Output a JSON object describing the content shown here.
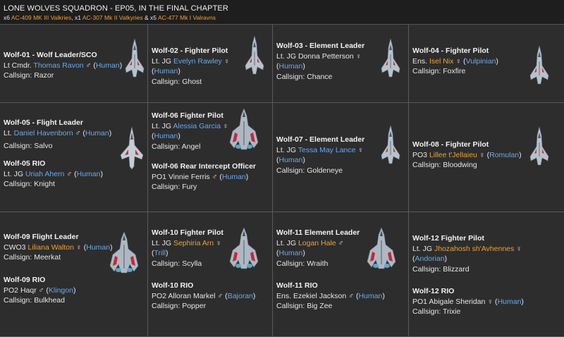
{
  "header": {
    "title": "LONE WOLVES SQUADRON - EP05, IN THE FINAL CHAPTER",
    "sub_prefix1": "x6",
    "ship1": "AC-409 MK III Valkries",
    "sub_mid1": ", x1",
    "ship2": "AC-307 Mk II Valkyries",
    "sub_mid2": " & x5",
    "ship3": "AC-477 Mk I Valravns"
  },
  "colors": {
    "accent_orange": "#f0a030",
    "link_blue": "#6aa9ea",
    "background": "#2b2b2b",
    "grid_line": "#5a5a5a"
  },
  "cells": [
    {
      "primary": {
        "role": "Wolf-01 - Wolf Leader/SCO",
        "rank": "Lt Cmdr.",
        "name": "Thomas Ravon",
        "gender": "♂",
        "species": "Human",
        "callsign_label": "Callsign:",
        "callsign": "Razor"
      },
      "ship_icon": "valkyrie-fighter-icon"
    },
    {
      "primary": {
        "role": "Wolf-02 - Fighter Pilot",
        "rank": "Lt. JG",
        "name": "Evelyn Rawley",
        "gender": "♀",
        "species": "Human",
        "callsign_label": "Callsign:",
        "callsign": "Ghost"
      },
      "ship_icon": "valkyrie-fighter-icon"
    },
    {
      "primary": {
        "role": "Wolf-03 - Element Leader",
        "rank": "Lt. JG",
        "name": "Donna Petterson",
        "gender": "♀",
        "species": "Human",
        "callsign_label": "Callsign:",
        "callsign": "Chance"
      },
      "ship_icon": "valkyrie-fighter-icon"
    },
    {
      "primary": {
        "role": "Wolf-04 - Fighter Pilot",
        "rank": "Ens.",
        "name": "Isel Nix",
        "gender": "♀",
        "species": "Vulpinian",
        "callsign_label": "Callsign:",
        "callsign": "Foxfire"
      },
      "ship_icon": "valkyrie-fighter-icon"
    },
    {
      "primary": {
        "role": "Wolf-05 - Flight Leader",
        "rank": "Lt.",
        "name": "Daniel Havenborn",
        "gender": "♂",
        "species": "Human",
        "callsign_label": "Callsign:",
        "callsign": "Salvo"
      },
      "secondary": {
        "role": "Wolf-05 RIO",
        "rank": "Lt. JG",
        "name": "Uriah Ahern",
        "gender": "♂",
        "species": "Human",
        "callsign_label": "Callsign:",
        "callsign": "Knight"
      },
      "ship_icon": "valkyrie-mk2-icon"
    },
    {
      "primary": {
        "role": "Wolf-06 Fighter Pilot",
        "rank": "Lt. JG",
        "name": "Alessia Garcia",
        "gender": "♀",
        "species": "Human",
        "callsign_label": "Callsign:",
        "callsign": "Angel"
      },
      "secondary": {
        "role": "Wolf-06 Rear Intercept Officer",
        "rank": "PO1",
        "name": "Vinnie Ferris",
        "gender": "♂",
        "species": "Human",
        "callsign_label": "Callsign:",
        "callsign": "Fury"
      },
      "ship_icon": "valravn-fighter-icon"
    },
    {
      "primary": {
        "role": "Wolf-07 - Element Leader",
        "rank": "Lt. JG",
        "name": "Tessa May Lance",
        "gender": "♀",
        "species": "Human",
        "callsign_label": "Callsign:",
        "callsign": "Goldeneye"
      },
      "ship_icon": "valkyrie-fighter-icon"
    },
    {
      "primary": {
        "role": "Wolf-08 - Fighter Pilot",
        "rank": "PO3",
        "name": "Lillee t'Jellaieu",
        "gender": "♀",
        "species": "Romulan",
        "callsign_label": "Callsign:",
        "callsign": "Bloodwing"
      },
      "ship_icon": "valkyrie-fighter-icon"
    },
    {
      "primary": {
        "role": "Wolf-09 Flight Leader",
        "rank": "CWO3",
        "name": "Liliana Walton",
        "gender": "♀",
        "species": "Human",
        "callsign_label": "Callsign:",
        "callsign": "Meerkat"
      },
      "secondary": {
        "role": "Wolf-09 RIO",
        "rank": "PO2",
        "name": "Haqr",
        "gender": "♂",
        "species": "Klingon",
        "callsign_label": "Callsign:",
        "callsign": "Bulkhead"
      },
      "ship_icon": "valravn-fighter-icon"
    },
    {
      "primary": {
        "role": "Wolf-10 Fighter Pilot",
        "rank": "Lt. JG",
        "name": "Sephiria Arn",
        "gender": "♀",
        "species": "Trill",
        "callsign_label": "Callsign:",
        "callsign": "Scylla"
      },
      "secondary": {
        "role": "Wolf-10 RIO",
        "rank": "PO2",
        "name": "Alloran Markel",
        "gender": "♂",
        "species": "Bajoran",
        "callsign_label": "Callsign:",
        "callsign": "Popper"
      },
      "ship_icon": "valravn-fighter-icon"
    },
    {
      "primary": {
        "role": "Wolf-11 Element Leader",
        "rank": "Lt. JG",
        "name": "Logan Hale",
        "gender": "♂",
        "species": "Human",
        "callsign_label": "Callsign:",
        "callsign": "Wraith"
      },
      "secondary": {
        "role": "Wolf-11 RIO",
        "rank": "Ens.",
        "name": "Ezekiel Jackson",
        "gender": "♂",
        "species": "Human",
        "callsign_label": "Callsign:",
        "callsign": "Big Zee"
      },
      "ship_icon": "valravn-fighter-icon"
    },
    {
      "primary": {
        "role": "Wolf-12 Fighter Pilot",
        "rank": "Lt. JG",
        "name": "Jhozahosh sh'Avhennes",
        "gender": "♀",
        "species": "Andorian",
        "callsign_label": "Callsign:",
        "callsign": "Blizzard"
      },
      "secondary": {
        "role": "Wolf-12 RIO",
        "rank": "PO1",
        "name": "Abigale Sheridan",
        "gender": "♀",
        "species": "Human",
        "callsign_label": "Callsign:",
        "callsign": "Trixie"
      },
      "ship_icon": "valravn-fighter-icon"
    }
  ]
}
